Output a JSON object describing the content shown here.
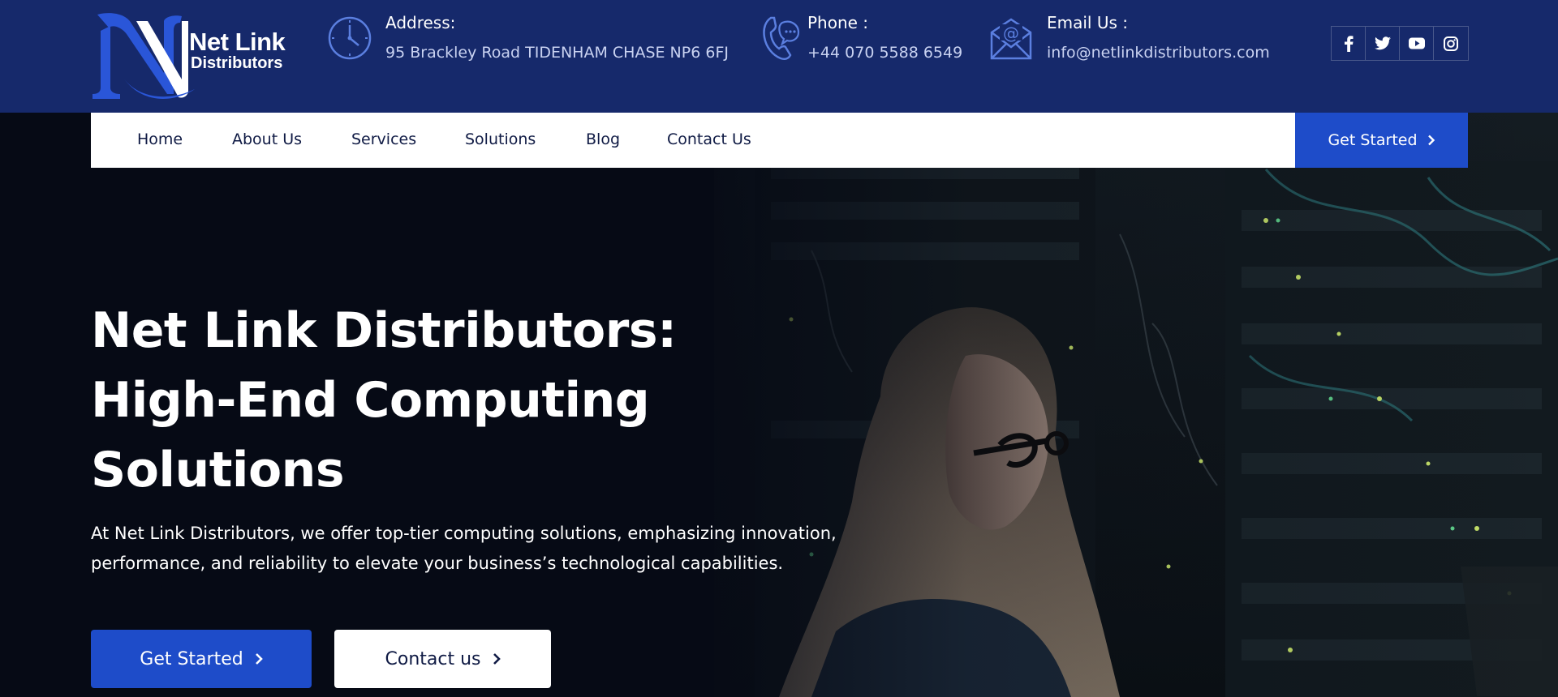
{
  "brand": {
    "name_line1": "Net Link",
    "name_line2": "Distributors",
    "logo_letter": "N"
  },
  "contact": {
    "address": {
      "label": "Address:",
      "value": "95 Brackley Road TIDENHAM CHASE NP6 6FJ",
      "icon": "clock-icon"
    },
    "phone": {
      "label": "Phone :",
      "value": "+44 070 5588 6549",
      "icon": "phone-icon"
    },
    "email": {
      "label": "Email Us :",
      "value": "info@netlinkdistributors.com",
      "icon": "mail-icon"
    }
  },
  "socials": [
    "facebook-icon",
    "twitter-icon",
    "youtube-icon",
    "instagram-icon"
  ],
  "nav": {
    "items": [
      "Home",
      "About Us",
      "Services",
      "Solutions",
      "Blog",
      "Contact Us"
    ],
    "cta": "Get Started"
  },
  "hero": {
    "title_lines": [
      "Net Link Distributors:",
      "High-End Computing",
      "Solutions"
    ],
    "description_lines": [
      "At Net Link Distributors, we offer top-tier computing solutions, emphasizing innovation,",
      "performance, and reliability to elevate your business’s technological capabilities."
    ],
    "primary_button": "Get Started",
    "secondary_button": "Contact us"
  },
  "colors": {
    "topbar": "#16296b",
    "accent": "#1e4cc9",
    "nav_text": "#0f1a44",
    "hero_bg": "#060a15"
  }
}
